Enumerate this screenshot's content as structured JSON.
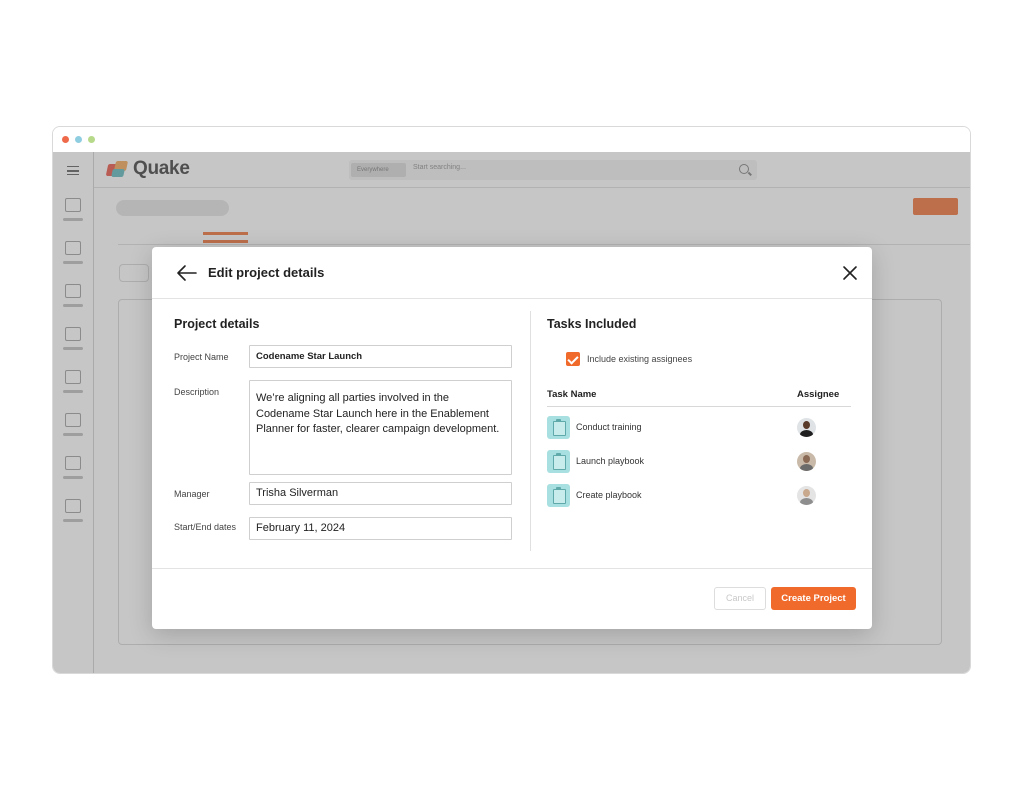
{
  "app": {
    "logo_text": "Quake"
  },
  "search": {
    "scope": "Everywhere",
    "placeholder": "Start searching..."
  },
  "modal": {
    "title": "Edit project details",
    "project_section_title": "Project details",
    "fields": {
      "project_name_label": "Project Name",
      "project_name_value": "Codename Star Launch",
      "description_label": "Description",
      "description_value": "We’re aligning all parties involved in the Codename Star Launch here in the Enablement Planner for faster, clearer campaign development.",
      "manager_label": "Manager",
      "manager_value": "Trisha Silverman",
      "dates_label": "Start/End dates",
      "dates_value": "February 11, 2024"
    },
    "tasks_section_title": "Tasks Included",
    "include_assignees_label": "Include existing assignees",
    "include_assignees_checked": true,
    "table_headers": {
      "task_name": "Task Name",
      "assignee": "Assignee"
    },
    "tasks": [
      {
        "name": "Conduct training",
        "avatar_icon": "avatar-icon"
      },
      {
        "name": "Launch playbook",
        "avatar_icon": "avatar-icon"
      },
      {
        "name": "Create playbook",
        "avatar_icon": "avatar-icon"
      }
    ],
    "cancel_label": "Cancel",
    "create_label": "Create Project"
  },
  "colors": {
    "accent": "#f06a2c",
    "task_icon_bg": "#a8dfe0"
  }
}
